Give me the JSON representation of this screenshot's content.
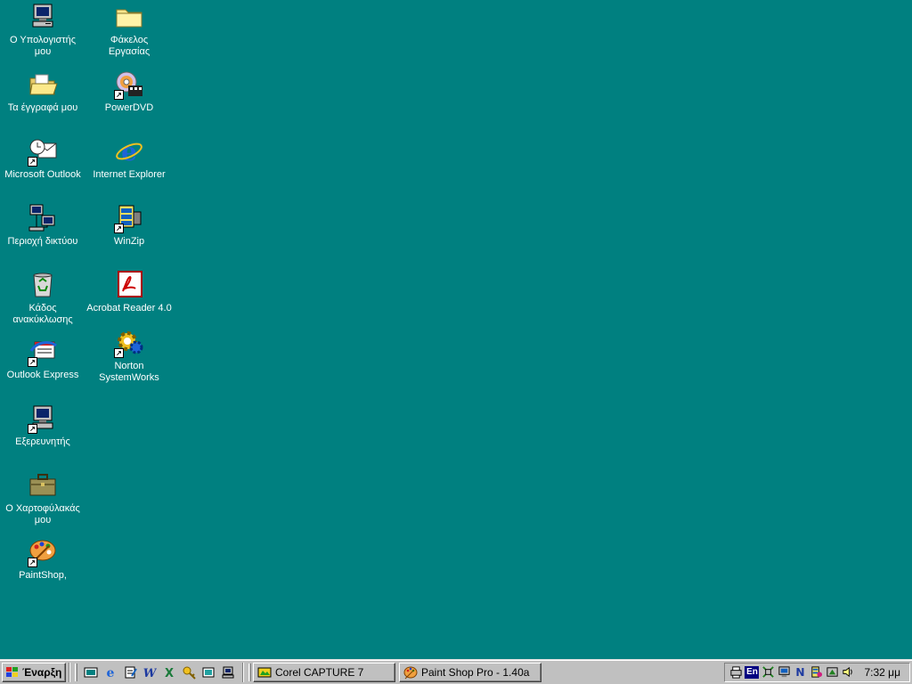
{
  "desktop": {
    "background": "#008080",
    "icons": [
      {
        "id": "my-computer",
        "label": "Ο Υπολογιστής\nμου",
        "icon": "computer-icon"
      },
      {
        "id": "work-folder",
        "label": "Φάκελος\nΕργασίας",
        "icon": "folder-icon"
      },
      {
        "id": "my-documents",
        "label": "Τα έγγραφά μου",
        "icon": "open-folder-icon"
      },
      {
        "id": "powerdvd",
        "label": "PowerDVD",
        "icon": "dvd-icon"
      },
      {
        "id": "microsoft-outlook",
        "label": "Microsoft Outlook",
        "icon": "outlook-icon"
      },
      {
        "id": "internet-explorer",
        "label": "Internet Explorer",
        "icon": "ie-icon"
      },
      {
        "id": "network-neighborhood",
        "label": "Περιοχή δικτύου",
        "icon": "network-icon"
      },
      {
        "id": "winzip",
        "label": "WinZip",
        "icon": "winzip-icon"
      },
      {
        "id": "recycle-bin",
        "label": "Κάδος\nανακύκλωσης",
        "icon": "recycle-bin-icon"
      },
      {
        "id": "acrobat-reader",
        "label": "Acrobat Reader 4.0",
        "icon": "acrobat-icon"
      },
      {
        "id": "outlook-express",
        "label": "Outlook Express",
        "icon": "outlook-express-icon"
      },
      {
        "id": "norton-systemworks",
        "label": "Norton\nSystemWorks",
        "icon": "norton-icon"
      },
      {
        "id": "explorer",
        "label": "Εξερευνητής",
        "icon": "explorer-icon"
      },
      {
        "id": "briefcase",
        "label": "Ο Χαρτοφύλακάς\nμου",
        "icon": "briefcase-icon"
      },
      {
        "id": "paintshop",
        "label": "PaintShop,",
        "icon": "palette-icon"
      }
    ]
  },
  "taskbar": {
    "start_label": "Έναρξη",
    "quick_launch": [
      "show-desktop-icon",
      "ie-icon",
      "notepad-icon",
      "word-icon",
      "excel-icon",
      "search-key-icon",
      "channel-icon",
      "computer-icon"
    ],
    "tasks": [
      {
        "label": "Corel CAPTURE 7",
        "icon": "corel-capture-icon"
      },
      {
        "label": "Paint Shop Pro - 1.40a",
        "icon": "palette-icon"
      }
    ],
    "tray": {
      "language": "En",
      "icons": [
        "printer-icon",
        "network-tray-icon",
        "display-icon",
        "norton-tray-icon",
        "winzip-tray-icon",
        "tool-tray-icon",
        "volume-icon"
      ],
      "clock": "7:32 μμ"
    }
  }
}
